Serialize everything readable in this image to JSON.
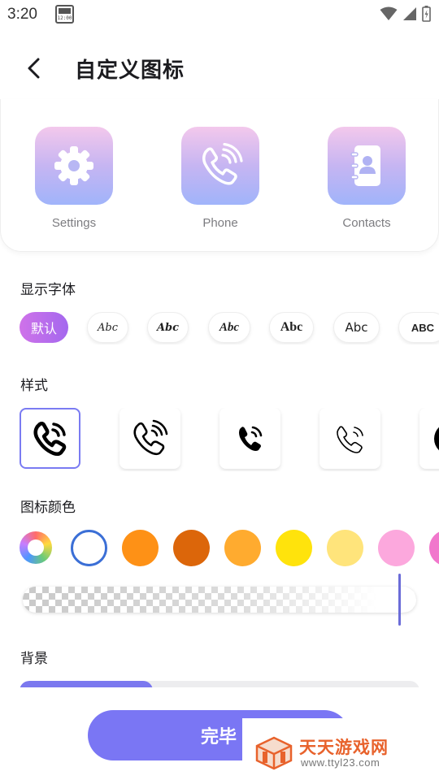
{
  "status_bar": {
    "time": "3:20",
    "calendar_badge": "12:00"
  },
  "header": {
    "title": "自定义图标"
  },
  "preview": {
    "apps": [
      {
        "label": "Settings",
        "icon": "gear-icon"
      },
      {
        "label": "Phone",
        "icon": "phone-wave-icon"
      },
      {
        "label": "Contacts",
        "icon": "contact-book-icon"
      }
    ]
  },
  "font_section": {
    "title": "显示字体",
    "options": [
      "默认",
      "Abc",
      "Abc",
      "Abc",
      "Abc",
      "Abc",
      "ABC"
    ],
    "selected_index": 0
  },
  "style_section": {
    "title": "样式",
    "options": [
      "phone-bold-icon",
      "phone-outline-wave-icon",
      "phone-solid-small-icon",
      "phone-thin-icon",
      "phone-circle-icon"
    ],
    "selected_index": 0
  },
  "color_section": {
    "title": "图标颜色",
    "swatches": [
      "spectrum",
      "#ffffff",
      "#fe9116",
      "#dc660a",
      "#ffab2f",
      "#ffe30c",
      "#ffe47b",
      "#fca8dd",
      "#f177cc"
    ],
    "selected_index": 1,
    "selected_ring_color": "#3b6fd6",
    "opacity_value": 0.96
  },
  "background_section": {
    "title": "背景"
  },
  "footer": {
    "done_label": "完毕"
  },
  "watermark": {
    "name": "天天游戏网",
    "url": "www.ttyl23.com"
  },
  "colors": {
    "accent": "#7a76f4",
    "tile_gradient_top": "#f3c8ec",
    "tile_gradient_bottom": "#a0b4fa"
  }
}
